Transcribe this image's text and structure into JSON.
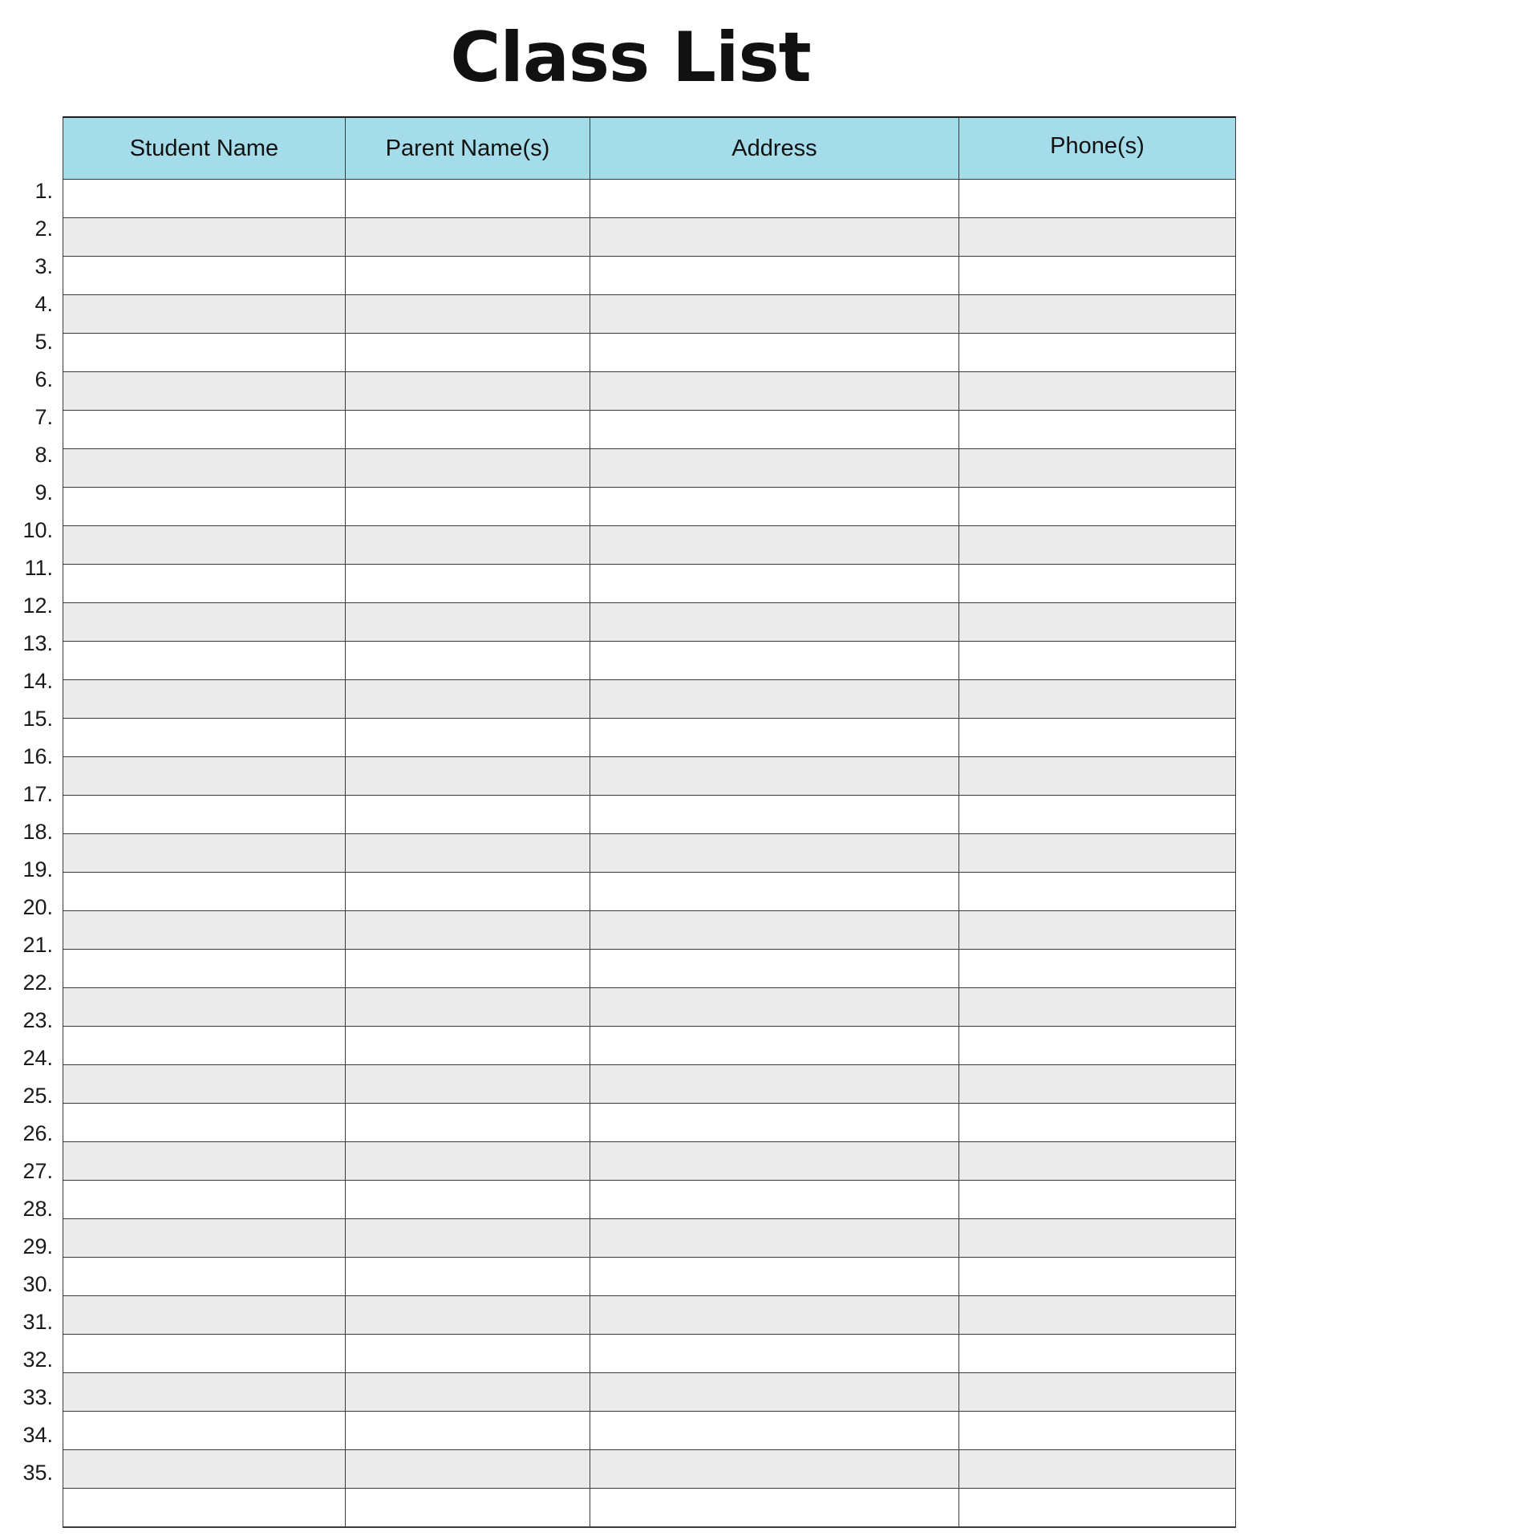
{
  "document": {
    "title": "Class List"
  },
  "table": {
    "columns": [
      {
        "key": "student_name",
        "label": "Student Name"
      },
      {
        "key": "parent_names",
        "label": "Parent Name(s)"
      },
      {
        "key": "address",
        "label": "Address"
      },
      {
        "key": "phones",
        "label": "Phone(s)"
      }
    ],
    "row_count": 35,
    "row_numbers": [
      "1.",
      "2.",
      "3.",
      "4.",
      "5.",
      "6.",
      "7.",
      "8.",
      "9.",
      "10.",
      "11.",
      "12.",
      "13.",
      "14.",
      "15.",
      "16.",
      "17.",
      "18.",
      "19.",
      "20.",
      "21.",
      "22.",
      "23.",
      "24.",
      "25.",
      "26.",
      "27.",
      "28.",
      "29.",
      "30.",
      "31.",
      "32.",
      "33.",
      "34.",
      "35."
    ],
    "rows": [
      {
        "student_name": "",
        "parent_names": "",
        "address": "",
        "phones": ""
      },
      {
        "student_name": "",
        "parent_names": "",
        "address": "",
        "phones": ""
      },
      {
        "student_name": "",
        "parent_names": "",
        "address": "",
        "phones": ""
      },
      {
        "student_name": "",
        "parent_names": "",
        "address": "",
        "phones": ""
      },
      {
        "student_name": "",
        "parent_names": "",
        "address": "",
        "phones": ""
      },
      {
        "student_name": "",
        "parent_names": "",
        "address": "",
        "phones": ""
      },
      {
        "student_name": "",
        "parent_names": "",
        "address": "",
        "phones": ""
      },
      {
        "student_name": "",
        "parent_names": "",
        "address": "",
        "phones": ""
      },
      {
        "student_name": "",
        "parent_names": "",
        "address": "",
        "phones": ""
      },
      {
        "student_name": "",
        "parent_names": "",
        "address": "",
        "phones": ""
      },
      {
        "student_name": "",
        "parent_names": "",
        "address": "",
        "phones": ""
      },
      {
        "student_name": "",
        "parent_names": "",
        "address": "",
        "phones": ""
      },
      {
        "student_name": "",
        "parent_names": "",
        "address": "",
        "phones": ""
      },
      {
        "student_name": "",
        "parent_names": "",
        "address": "",
        "phones": ""
      },
      {
        "student_name": "",
        "parent_names": "",
        "address": "",
        "phones": ""
      },
      {
        "student_name": "",
        "parent_names": "",
        "address": "",
        "phones": ""
      },
      {
        "student_name": "",
        "parent_names": "",
        "address": "",
        "phones": ""
      },
      {
        "student_name": "",
        "parent_names": "",
        "address": "",
        "phones": ""
      },
      {
        "student_name": "",
        "parent_names": "",
        "address": "",
        "phones": ""
      },
      {
        "student_name": "",
        "parent_names": "",
        "address": "",
        "phones": ""
      },
      {
        "student_name": "",
        "parent_names": "",
        "address": "",
        "phones": ""
      },
      {
        "student_name": "",
        "parent_names": "",
        "address": "",
        "phones": ""
      },
      {
        "student_name": "",
        "parent_names": "",
        "address": "",
        "phones": ""
      },
      {
        "student_name": "",
        "parent_names": "",
        "address": "",
        "phones": ""
      },
      {
        "student_name": "",
        "parent_names": "",
        "address": "",
        "phones": ""
      },
      {
        "student_name": "",
        "parent_names": "",
        "address": "",
        "phones": ""
      },
      {
        "student_name": "",
        "parent_names": "",
        "address": "",
        "phones": ""
      },
      {
        "student_name": "",
        "parent_names": "",
        "address": "",
        "phones": ""
      },
      {
        "student_name": "",
        "parent_names": "",
        "address": "",
        "phones": ""
      },
      {
        "student_name": "",
        "parent_names": "",
        "address": "",
        "phones": ""
      },
      {
        "student_name": "",
        "parent_names": "",
        "address": "",
        "phones": ""
      },
      {
        "student_name": "",
        "parent_names": "",
        "address": "",
        "phones": ""
      },
      {
        "student_name": "",
        "parent_names": "",
        "address": "",
        "phones": ""
      },
      {
        "student_name": "",
        "parent_names": "",
        "address": "",
        "phones": ""
      },
      {
        "student_name": "",
        "parent_names": "",
        "address": "",
        "phones": ""
      }
    ]
  },
  "colors": {
    "header_background": "#a5dcea",
    "row_stripe": "#eaeaea",
    "row_plain": "#ffffff",
    "border": "#3a3a3a",
    "text": "#111111",
    "page_background": "#ffffff"
  }
}
